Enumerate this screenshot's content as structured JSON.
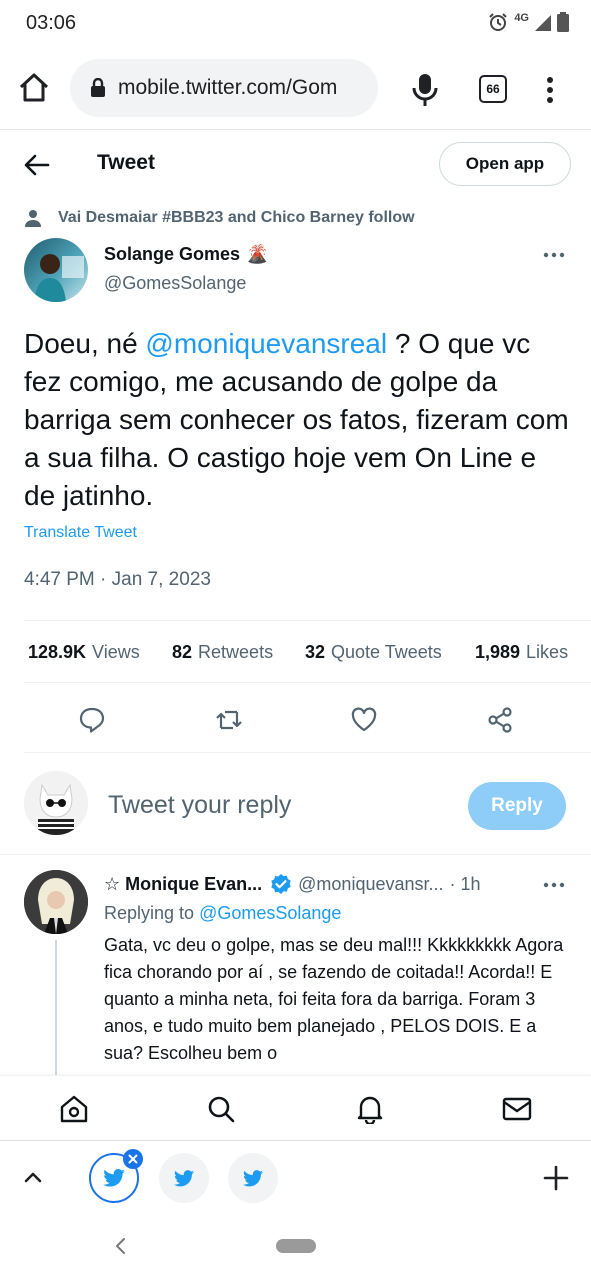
{
  "status": {
    "time": "03:06",
    "network": "4G"
  },
  "browser": {
    "url": "mobile.twitter.com/Gom",
    "tab_count": "66"
  },
  "header": {
    "title": "Tweet",
    "open_app": "Open app"
  },
  "tweet": {
    "social_context": "Vai Desmaiar #BBB23 and Chico Barney follow",
    "author_name": "Solange Gomes",
    "author_emoji": "🌋",
    "author_handle": "@GomesSolange",
    "text_pre": "Doeu, né ",
    "mention": "@moniquevansreal",
    "text_post": " ? O que vc fez comigo, me acusando de golpe da barriga sem conhecer os fatos, fizeram com a sua filha. O castigo hoje vem On Line e de jatinho.",
    "translate": "Translate Tweet",
    "timestamp": "4:47 PM · Jan 7, 2023",
    "stats": {
      "views_count": "128.9K",
      "views_label": "Views",
      "retweets_count": "82",
      "retweets_label": "Retweets",
      "quotes_count": "32",
      "quotes_label": "Quote Tweets",
      "likes_count": "1,989",
      "likes_label": "Likes"
    }
  },
  "reply_box": {
    "placeholder": "Tweet your reply",
    "button": "Reply"
  },
  "comment": {
    "name": "☆ Monique Evan...",
    "handle": "@moniquevansr...",
    "time": "· 1h",
    "replying_prefix": "Replying to ",
    "replying_to": "@GomesSolange",
    "text": "Gata, vc deu o golpe, mas se deu mal!!! Kkkkkkkkk  Agora fica chorando por aí , se fazendo de coitada!! Acorda!! E quanto a minha neta, foi feita fora da barriga. Foram 3 anos, e tudo muito bem planejado , PELOS DOIS. E a sua? Escolheu bem o"
  },
  "colors": {
    "accent": "#1d9bf0",
    "reply_button": "#8ecdf8",
    "muted": "#536471",
    "chrome_blue": "#1a73e8"
  },
  "icons": [
    "home-icon",
    "lock-icon",
    "mic-icon",
    "tabs-icon",
    "overflow-menu-icon",
    "back-arrow-icon",
    "person-icon",
    "more-icon",
    "reply-icon",
    "retweet-icon",
    "like-icon",
    "share-icon",
    "verified-icon",
    "search-icon",
    "notifications-icon",
    "messages-icon",
    "chevron-up-icon",
    "twitter-bird-icon",
    "plus-icon",
    "system-back-icon"
  ]
}
